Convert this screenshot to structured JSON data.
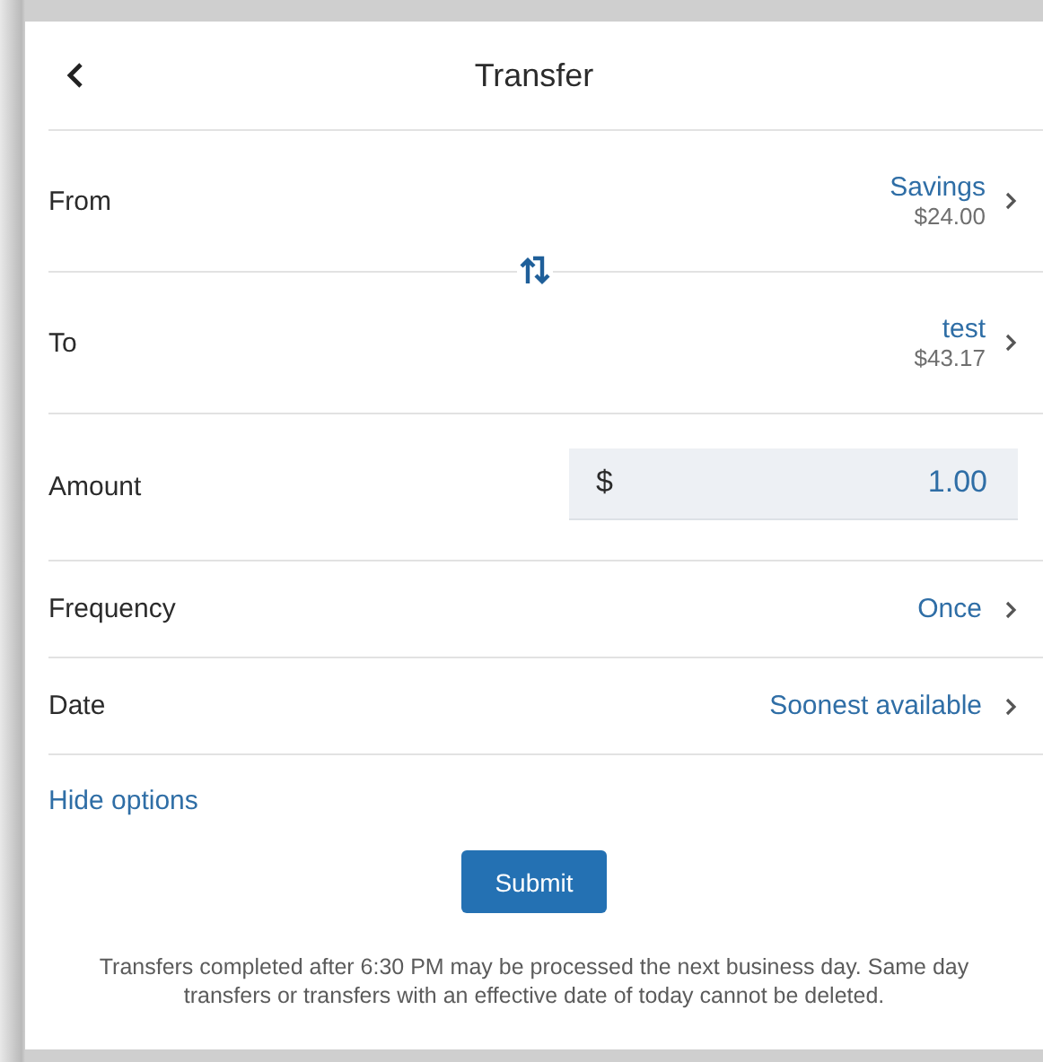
{
  "header": {
    "title": "Transfer"
  },
  "accounts": [
    {
      "kind": "account",
      "label": "From",
      "name": "Savings",
      "balance": "$24.00"
    },
    {
      "kind": "account",
      "label": "To",
      "name": "test",
      "balance": "$43.17"
    }
  ],
  "amount": {
    "label": "Amount",
    "currency": "$",
    "value": "1.00"
  },
  "options": [
    {
      "label": "Frequency",
      "value": "Once"
    },
    {
      "label": "Date",
      "value": "Soonest available"
    }
  ],
  "toggle_link": "Hide options",
  "submit": "Submit",
  "note": "Transfers completed after 6:30 PM may be processed the next business day. Same day transfers or transfers with an effective date of today cannot be deleted."
}
